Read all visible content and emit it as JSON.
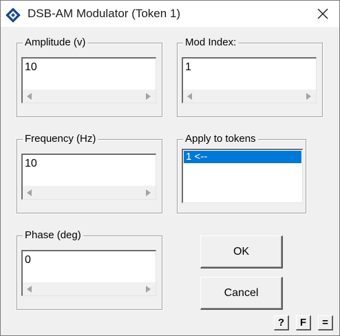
{
  "window": {
    "title": "DSB-AM Modulator (Token 1)",
    "close_glyph": "✕"
  },
  "amplitude": {
    "label": "Amplitude (v)",
    "value": "10"
  },
  "mod_index": {
    "label": "Mod Index:",
    "value": "1"
  },
  "frequency": {
    "label": "Frequency (Hz)",
    "value": "10"
  },
  "apply_tokens": {
    "label": "Apply to tokens",
    "items": [
      "1 <--"
    ],
    "selected": 0
  },
  "phase": {
    "label": "Phase (deg)",
    "value": "0"
  },
  "buttons": {
    "ok": "OK",
    "cancel": "Cancel",
    "help": "?",
    "f": "F",
    "equals": "="
  },
  "colors": {
    "selection": "#0078d7",
    "icon_blue": "#1f4e9c"
  }
}
